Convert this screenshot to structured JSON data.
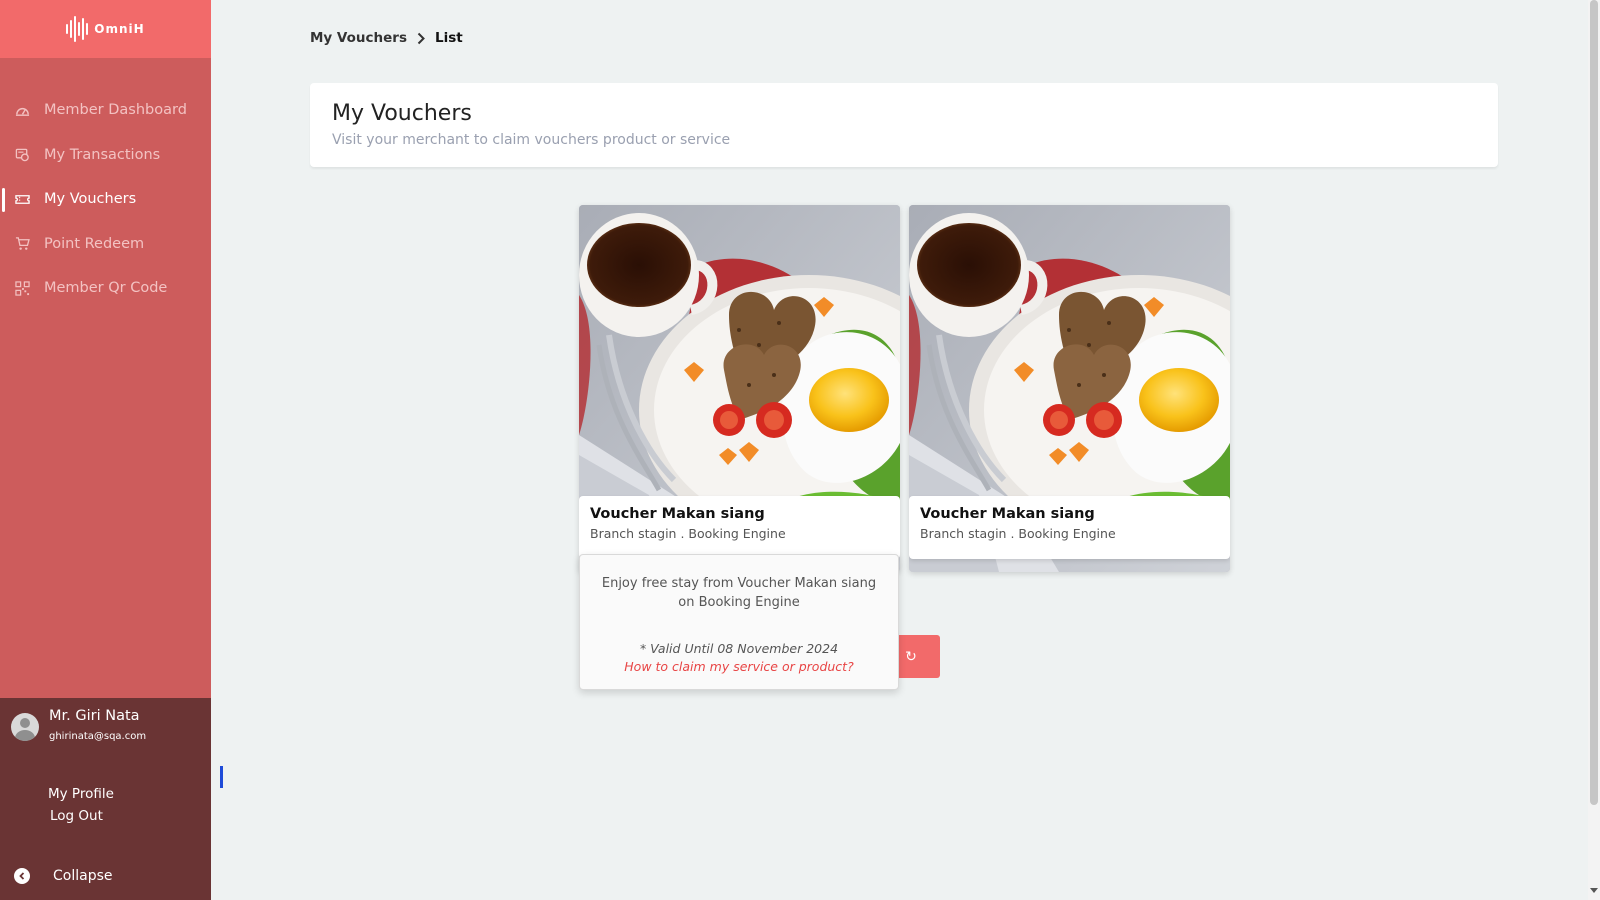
{
  "app": {
    "logo_text": "OmniH"
  },
  "sidebar": {
    "items": [
      {
        "label": "Member Dashboard",
        "icon": "gauge-icon",
        "active": false
      },
      {
        "label": "My Transactions",
        "icon": "transactions-icon",
        "active": false
      },
      {
        "label": "My Vouchers",
        "icon": "ticket-icon",
        "active": true
      },
      {
        "label": "Point Redeem",
        "icon": "cart-icon",
        "active": false
      },
      {
        "label": "Member Qr Code",
        "icon": "qr-code-icon",
        "active": false
      }
    ],
    "user": {
      "name": "Mr. Giri Nata",
      "email": "ghirinata@sqa.com",
      "profile_label": "My Profile",
      "logout_label": "Log Out"
    },
    "collapse_label": "Collapse"
  },
  "breadcrumb": {
    "parent": "My Vouchers",
    "current": "List"
  },
  "header": {
    "title": "My Vouchers",
    "subtitle": "Visit your merchant to claim vouchers product or service"
  },
  "vouchers": [
    {
      "title": "Voucher Makan siang",
      "subtitle": "Branch stagin . Booking Engine"
    },
    {
      "title": "Voucher Makan siang",
      "subtitle": "Branch stagin . Booking Engine"
    }
  ],
  "popover": {
    "description": "Enjoy free stay from Voucher Makan siang on Booking Engine",
    "valid_until": "* Valid Until 08 November 2024",
    "how_to_claim": "How to claim my service or product?"
  },
  "refresh_button": {
    "icon": "refresh-icon",
    "glyph": "↻"
  },
  "colors": {
    "sidebar": "#cd5c5c",
    "logo_bar": "#f26a6a",
    "user_panel": "#6a3434",
    "accent": "#f26a6a",
    "link_red": "#e84545",
    "background": "#eef2f2"
  }
}
